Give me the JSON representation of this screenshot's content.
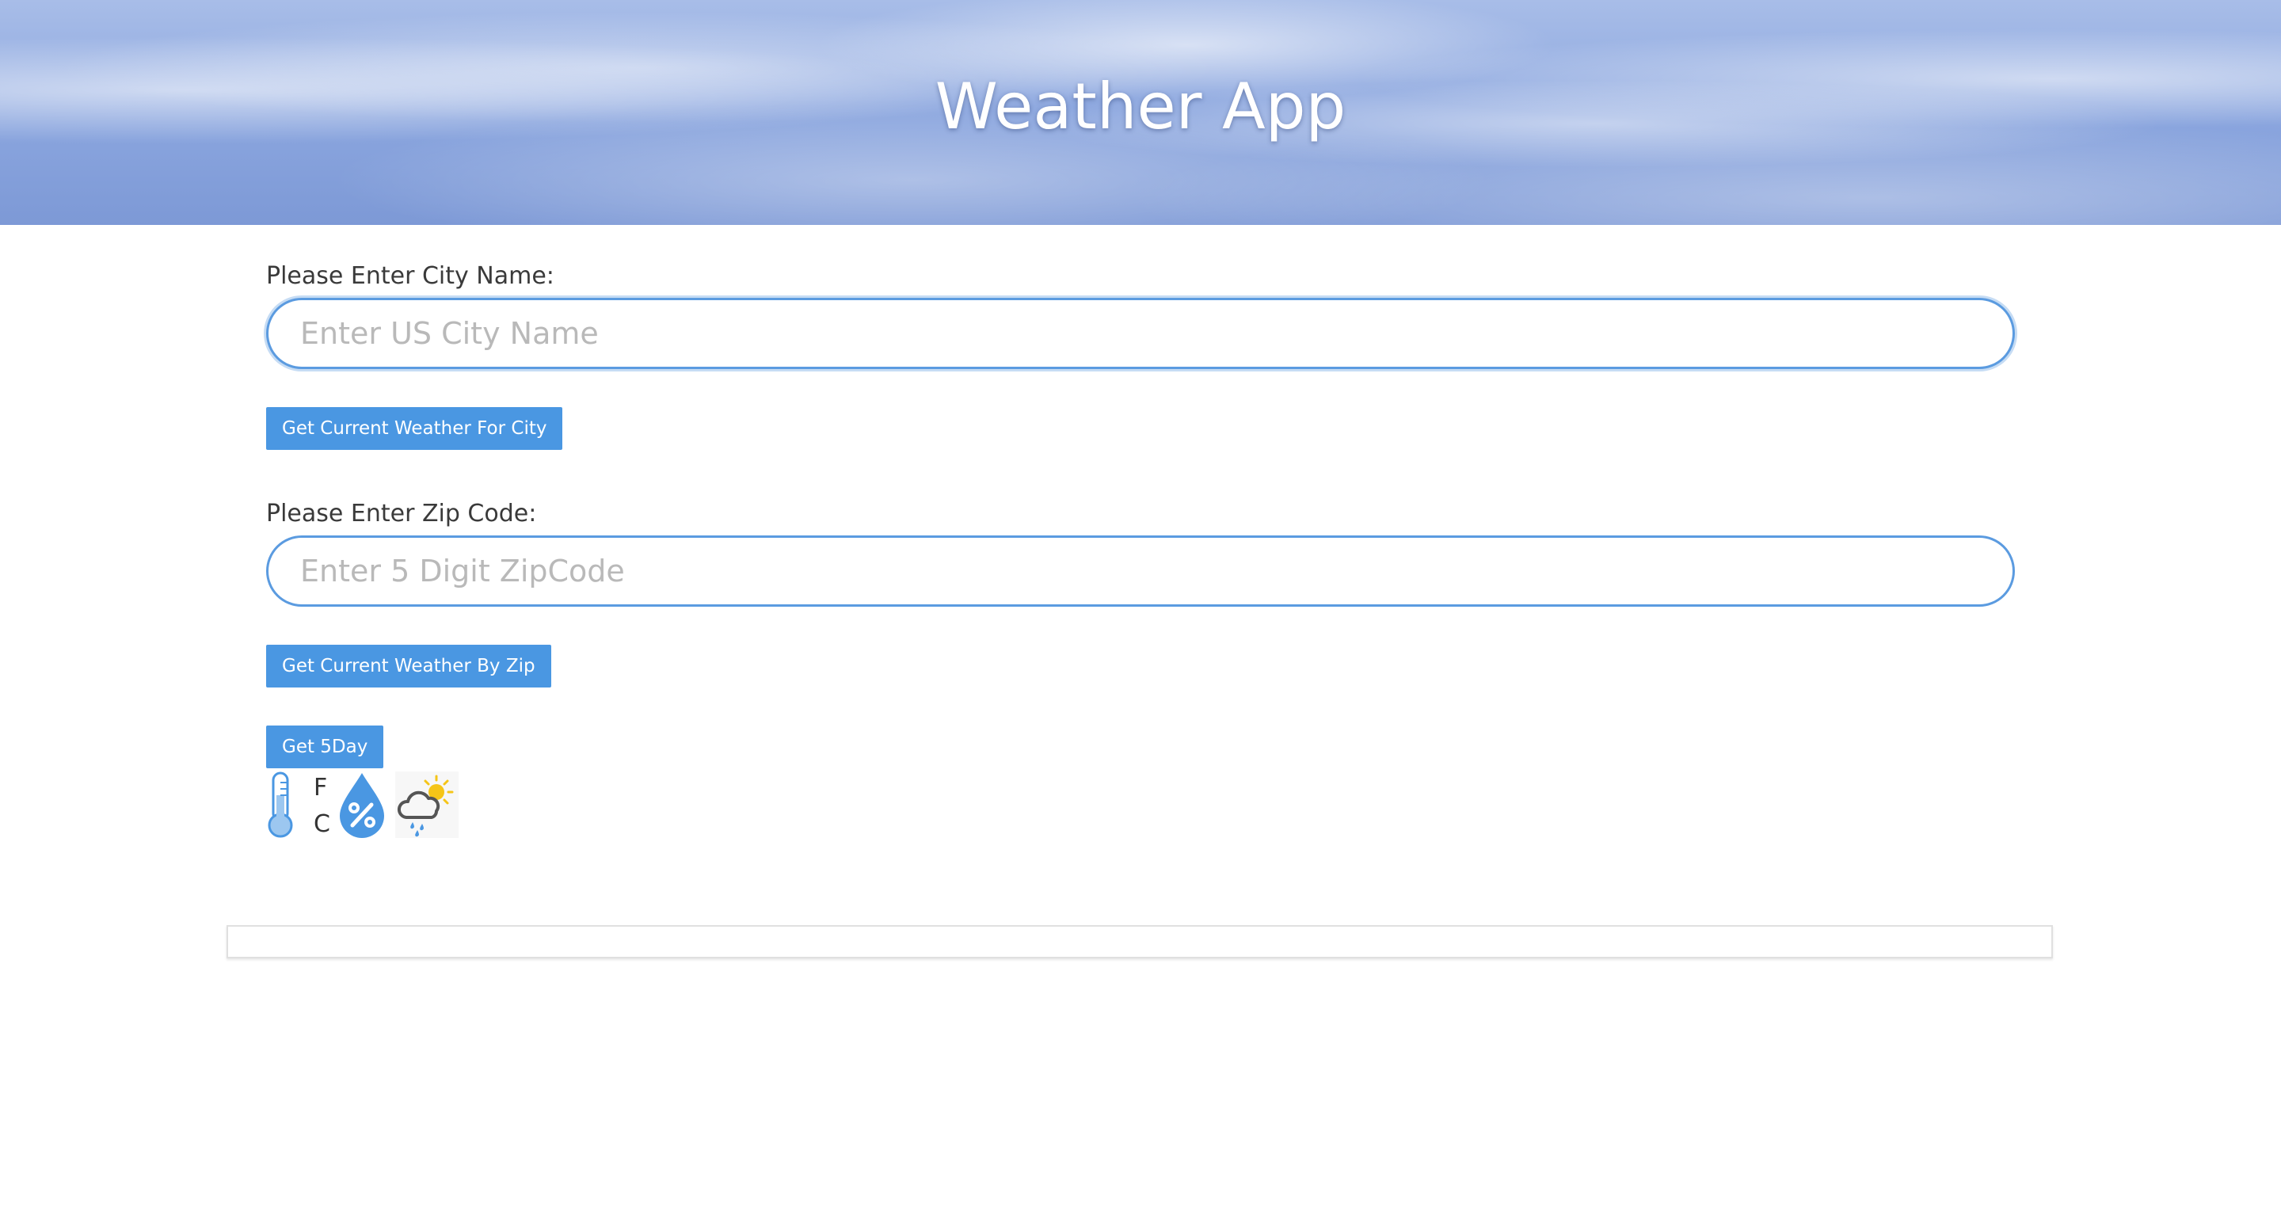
{
  "header": {
    "title": "Weather App"
  },
  "city_form": {
    "label": "Please Enter City Name:",
    "placeholder": "Enter US City Name",
    "value": "",
    "button_label": "Get Current Weather For City"
  },
  "zip_form": {
    "label": "Please Enter Zip Code:",
    "placeholder": "Enter 5 Digit ZipCode",
    "value": "",
    "button_label": "Get Current Weather By Zip"
  },
  "five_day": {
    "button_label": "Get 5Day"
  },
  "units": {
    "fahrenheit": "F",
    "celsius": "C"
  },
  "icons": {
    "temperature": "thermometer-icon",
    "humidity": "humidity-drop-icon",
    "conditions": "partly-sunny-rain-icon"
  },
  "colors": {
    "accent": "#4a97e2",
    "input_border": "#5b9be0",
    "sun": "#f5c518",
    "cloud": "#555555"
  }
}
